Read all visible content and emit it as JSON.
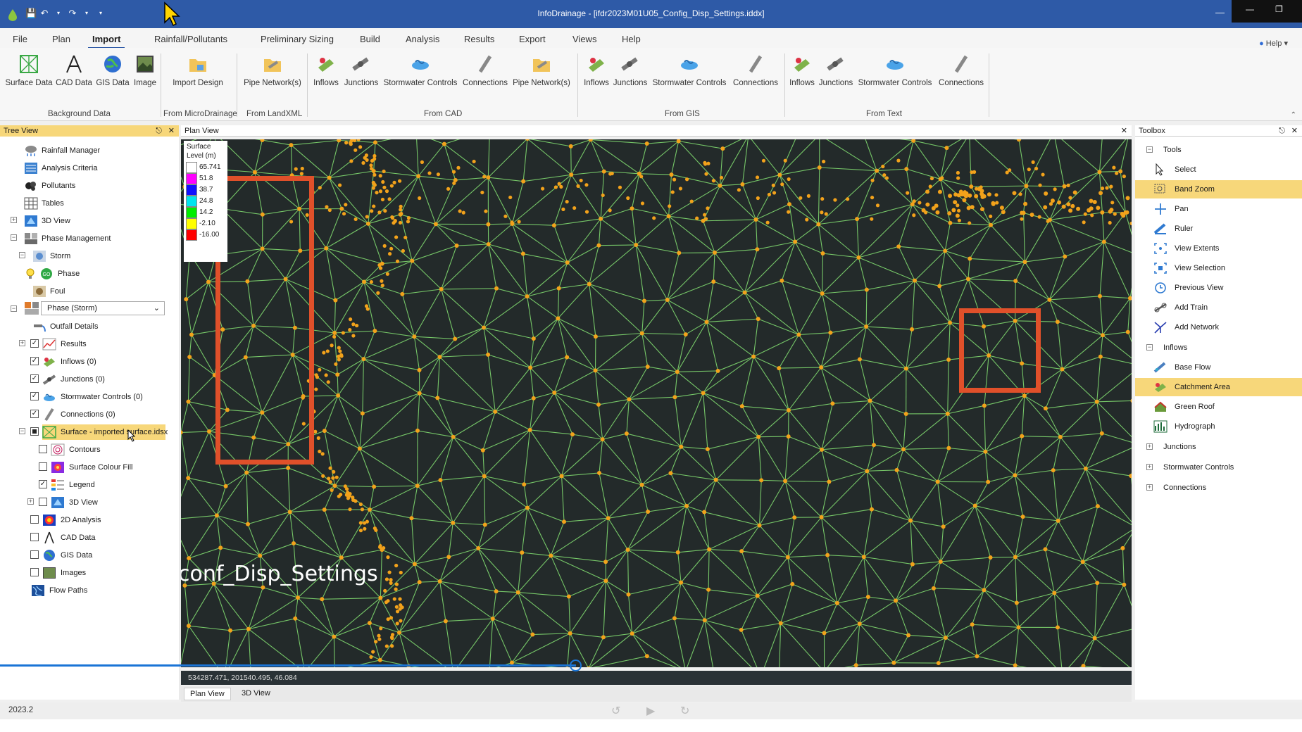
{
  "window": {
    "title": "InfoDrainage - [ifdr2023M01U05_Config_Disp_Settings.iddx]"
  },
  "menu": [
    "File",
    "Plan",
    "Import",
    "Rainfall/Pollutants",
    "Preliminary Sizing",
    "Build",
    "Analysis",
    "Results",
    "Export",
    "Views",
    "Help"
  ],
  "help_link": "Help",
  "ribbon": {
    "background_data": {
      "label": "Background Data",
      "buttons": [
        "Surface Data",
        "CAD Data",
        "GIS Data",
        "Image"
      ]
    },
    "from_microdrainage": {
      "label": "From MicroDrainage",
      "buttons": [
        "Import Design"
      ]
    },
    "from_landxml": {
      "label": "From LandXML",
      "buttons": [
        "Pipe Network(s)"
      ]
    },
    "from_cad": {
      "label": "From CAD",
      "buttons": [
        "Inflows",
        "Junctions",
        "Stormwater Controls",
        "Connections",
        "Pipe Network(s)"
      ]
    },
    "from_gis": {
      "label": "From GIS",
      "buttons": [
        "Inflows",
        "Junctions",
        "Stormwater Controls",
        "Connections"
      ]
    },
    "from_text": {
      "label": "From Text",
      "buttons": [
        "Inflows",
        "Junctions",
        "Stormwater Controls",
        "Connections"
      ]
    }
  },
  "tree_view": {
    "title": "Tree View",
    "items": {
      "rainfall_manager": "Rainfall Manager",
      "analysis_criteria": "Analysis Criteria",
      "pollutants": "Pollutants",
      "tables": "Tables",
      "view_3d": "3D View",
      "phase_management": "Phase Management",
      "storm": "Storm",
      "phase": "Phase",
      "foul": "Foul",
      "phase_select": "Phase (Storm)",
      "outfall_details": "Outfall Details",
      "results": "Results",
      "inflows": "Inflows (0)",
      "junctions": "Junctions (0)",
      "stormwater_controls": "Stormwater Controls (0)",
      "connections": "Connections (0)",
      "surface": "Surface - imported surface.idsx",
      "contours": "Contours",
      "surface_colour_fill": "Surface Colour Fill",
      "legend": "Legend",
      "surface_3d_view": "3D View",
      "analysis_2d": "2D Analysis",
      "cad_data": "CAD Data",
      "gis_data": "GIS Data",
      "images": "Images",
      "flow_paths": "Flow Paths"
    }
  },
  "plan_view": {
    "title": "Plan View",
    "legend_title": "Surface Level (m)",
    "legend_entries": [
      {
        "label": "65.741",
        "color": "#ffffff"
      },
      {
        "label": "51.8",
        "color": "#ff00ff"
      },
      {
        "label": "38.7",
        "color": "#1010ff"
      },
      {
        "label": "24.8",
        "color": "#00e5ee"
      },
      {
        "label": "14.2",
        "color": "#00ee00"
      },
      {
        "label": "-2.10",
        "color": "#ffff00"
      },
      {
        "label": "-16.00",
        "color": "#ff0000"
      }
    ],
    "overlay_text": "conf_Disp_Settings",
    "coordinates": "534287.471, 201540.495, 46.084",
    "tabs": [
      "Plan View",
      "3D View"
    ],
    "accent_colors": {
      "mesh_line": "#7fd86f",
      "node": "#f2a21b",
      "highlight_box": "#e0502a"
    }
  },
  "toolbox": {
    "title": "Toolbox",
    "tools_header": "Tools",
    "tools": [
      "Select",
      "Band Zoom",
      "Pan",
      "Ruler",
      "View Extents",
      "View Selection",
      "Previous View",
      "Add Train",
      "Add Network"
    ],
    "inflows_header": "Inflows",
    "inflows": [
      "Base Flow",
      "Catchment Area",
      "Green Roof",
      "Hydrograph"
    ],
    "collapsed": [
      "Junctions",
      "Stormwater Controls",
      "Connections"
    ]
  },
  "status": {
    "version": "2023.2"
  }
}
